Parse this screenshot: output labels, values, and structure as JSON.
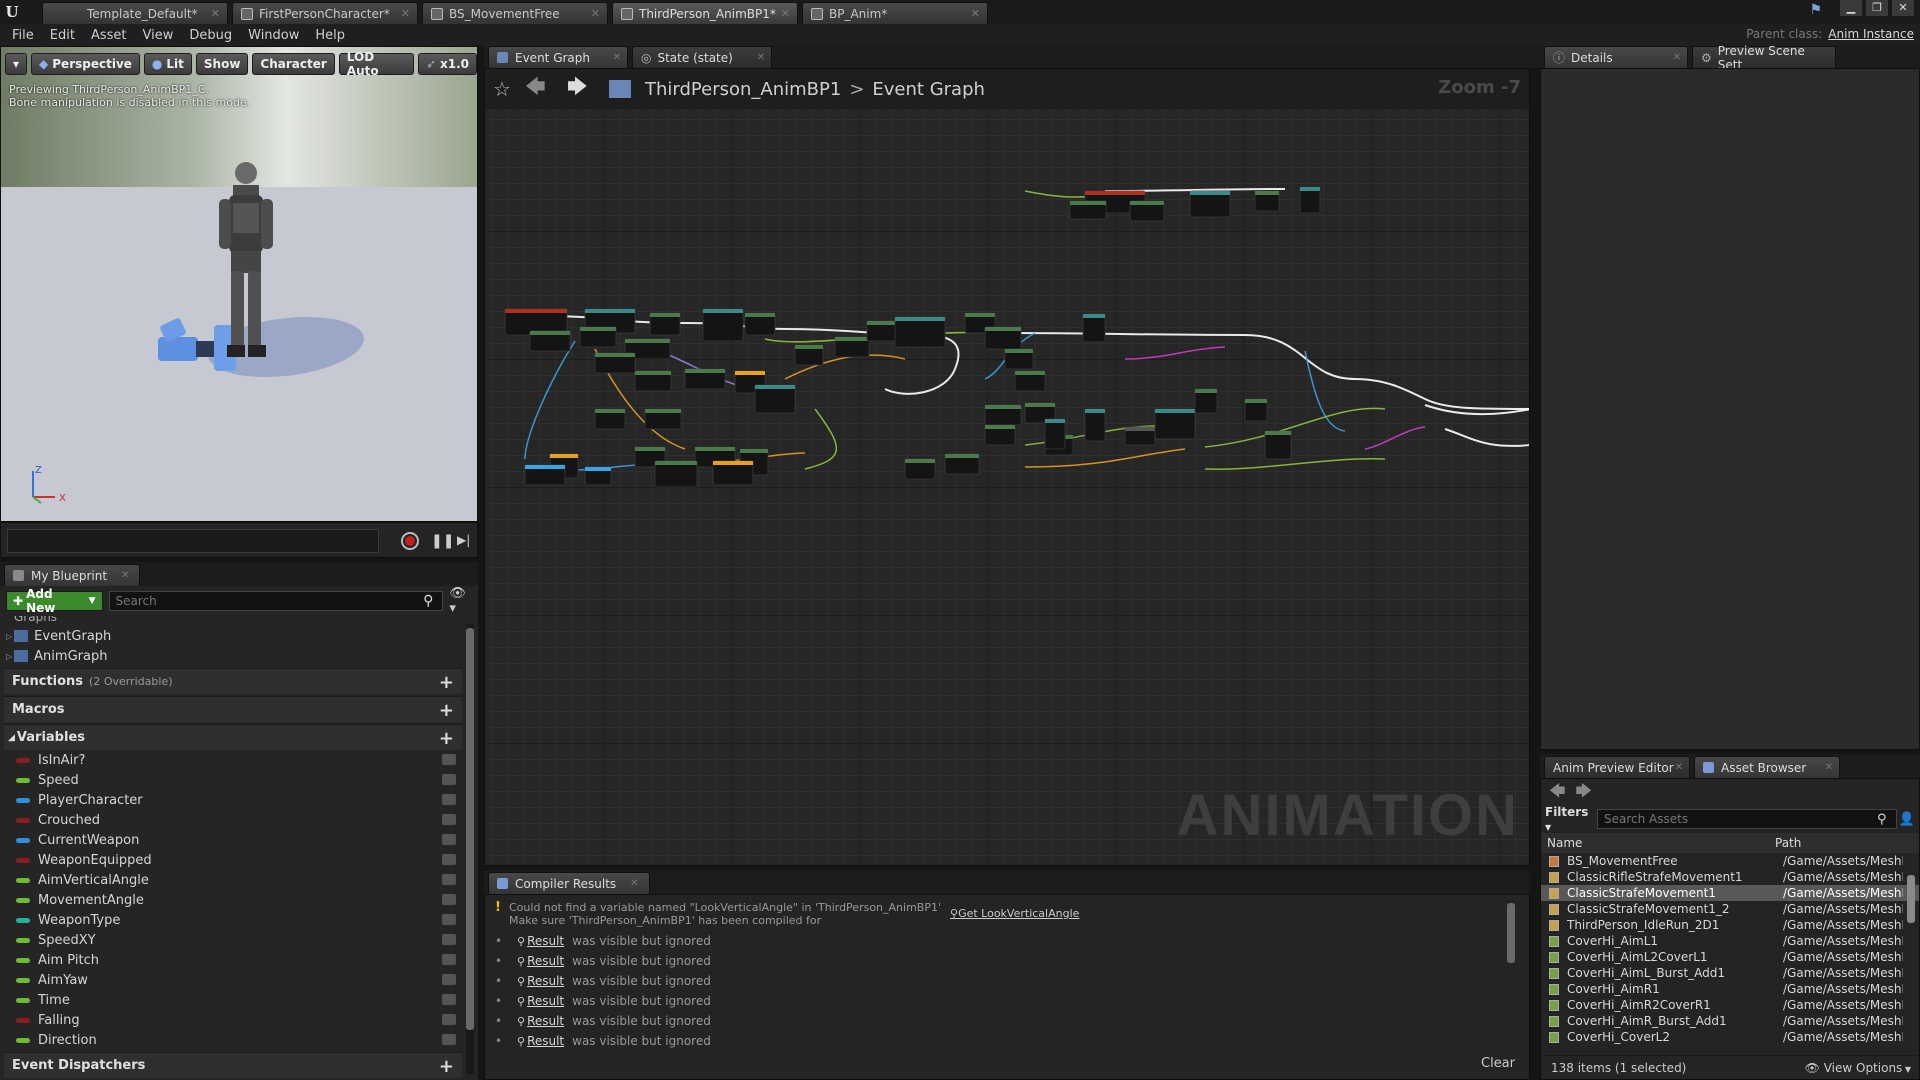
{
  "title_bar": {
    "tabs": [
      {
        "label": "Template_Default*",
        "active": false
      },
      {
        "label": "FirstPersonCharacter*",
        "active": false
      },
      {
        "label": "BS_MovementFree",
        "active": false
      },
      {
        "label": "ThirdPerson_AnimBP1*",
        "active": true
      },
      {
        "label": "BP_Anim*",
        "active": false
      }
    ]
  },
  "menu": {
    "items": [
      "File",
      "Edit",
      "Asset",
      "View",
      "Debug",
      "Window",
      "Help"
    ],
    "parent_class_label": "Parent class:",
    "parent_class_value": "Anim Instance"
  },
  "viewport": {
    "toolbar": {
      "perspective": "Perspective",
      "lit": "Lit",
      "show": "Show",
      "character": "Character",
      "lod": "LOD Auto",
      "speed": "x1.0"
    },
    "info_line1": "Previewing ThirdPerson_AnimBP1_C.",
    "info_line2": "Bone manipulation is disabled in this mode.",
    "axis_z": "Z",
    "axis_x": "X"
  },
  "my_blueprint": {
    "tab_label": "My Blueprint",
    "add_new_label": "Add New",
    "search_placeholder": "Search",
    "graphs_label": "Graphs",
    "graphs": [
      "EventGraph",
      "AnimGraph"
    ],
    "functions_label": "Functions",
    "functions_sub": "(2 Overridable)",
    "macros_label": "Macros",
    "variables_label": "Variables",
    "variables": [
      {
        "name": "IsInAir?",
        "color": "#8a1d1d"
      },
      {
        "name": "Speed",
        "color": "#6dbb2e"
      },
      {
        "name": "PlayerCharacter",
        "color": "#2d8fe0"
      },
      {
        "name": "Crouched",
        "color": "#8a1d1d"
      },
      {
        "name": "CurrentWeapon",
        "color": "#2d8fe0"
      },
      {
        "name": "WeaponEquipped",
        "color": "#8a1d1d"
      },
      {
        "name": "AimVerticalAngle",
        "color": "#6dbb2e"
      },
      {
        "name": "MovementAngle",
        "color": "#6dbb2e"
      },
      {
        "name": "WeaponType",
        "color": "#1fb3a0"
      },
      {
        "name": "SpeedXY",
        "color": "#6dbb2e"
      },
      {
        "name": "Aim Pitch",
        "color": "#6dbb2e"
      },
      {
        "name": "AimYaw",
        "color": "#6dbb2e"
      },
      {
        "name": "Time",
        "color": "#6dbb2e"
      },
      {
        "name": "Falling",
        "color": "#8a1d1d"
      },
      {
        "name": "Direction",
        "color": "#6dbb2e"
      }
    ],
    "event_dispatchers_label": "Event Dispatchers"
  },
  "event_graph": {
    "tabs": [
      {
        "label": "Event Graph",
        "active": true
      },
      {
        "label": "State (state)",
        "active": false
      }
    ],
    "breadcrumb_root": "ThirdPerson_AnimBP1",
    "breadcrumb_separator": ">",
    "breadcrumb_current": "Event Graph",
    "zoom": "Zoom -7",
    "watermark": "ANIMATION"
  },
  "compiler_results": {
    "tab_label": "Compiler Results",
    "warning_line1": "Could not find a variable named \"LookVerticalAngle\" in 'ThirdPerson_AnimBP1'",
    "warning_line2": "Make sure 'ThirdPerson_AnimBP1' has been compiled for",
    "warning_link": "Get LookVerticalAngle",
    "rows": [
      {
        "link": "Result",
        "text": "was visible but ignored"
      },
      {
        "link": "Result",
        "text": "was visible but ignored"
      },
      {
        "link": "Result",
        "text": "was visible but ignored"
      },
      {
        "link": "Result",
        "text": "was visible but ignored"
      },
      {
        "link": "Result",
        "text": "was visible but ignored"
      },
      {
        "link": "Result",
        "text": "was visible but ignored"
      }
    ],
    "clear_label": "Clear"
  },
  "right_panel": {
    "tabs": [
      {
        "label": "Details",
        "active": true
      },
      {
        "label": "Preview Scene Sett",
        "active": false
      }
    ]
  },
  "asset_browser": {
    "tabs": [
      {
        "label": "Anim Preview Editor",
        "active": false
      },
      {
        "label": "Asset Browser",
        "active": true
      }
    ],
    "filters_label": "Filters",
    "search_placeholder": "Search Assets",
    "col_name": "Name",
    "col_path": "Path",
    "rows": [
      {
        "name": "BS_MovementFree",
        "path": "/Game/Assets/MeshF",
        "selected": false
      },
      {
        "name": "ClassicRifleStrafeMovement1",
        "path": "/Game/Assets/MeshF",
        "selected": false
      },
      {
        "name": "ClassicStrafeMovement1",
        "path": "/Game/Assets/MeshF",
        "selected": true
      },
      {
        "name": "ClassicStrafeMovement1_2",
        "path": "/Game/Assets/MeshF",
        "selected": false
      },
      {
        "name": "ThirdPerson_IdleRun_2D1",
        "path": "/Game/Assets/MeshF",
        "selected": false
      },
      {
        "name": "CoverHi_AimL1",
        "path": "/Game/Assets/MeshF",
        "selected": false
      },
      {
        "name": "CoverHi_AimL2CoverL1",
        "path": "/Game/Assets/MeshF",
        "selected": false
      },
      {
        "name": "CoverHi_AimL_Burst_Add1",
        "path": "/Game/Assets/MeshF",
        "selected": false
      },
      {
        "name": "CoverHi_AimR1",
        "path": "/Game/Assets/MeshF",
        "selected": false
      },
      {
        "name": "CoverHi_AimR2CoverR1",
        "path": "/Game/Assets/MeshF",
        "selected": false
      },
      {
        "name": "CoverHi_AimR_Burst_Add1",
        "path": "/Game/Assets/MeshF",
        "selected": false
      },
      {
        "name": "CoverHi_CoverL2",
        "path": "/Game/Assets/MeshF",
        "selected": false
      }
    ],
    "footer": "138 items (1 selected)",
    "view_options": "View Options"
  }
}
